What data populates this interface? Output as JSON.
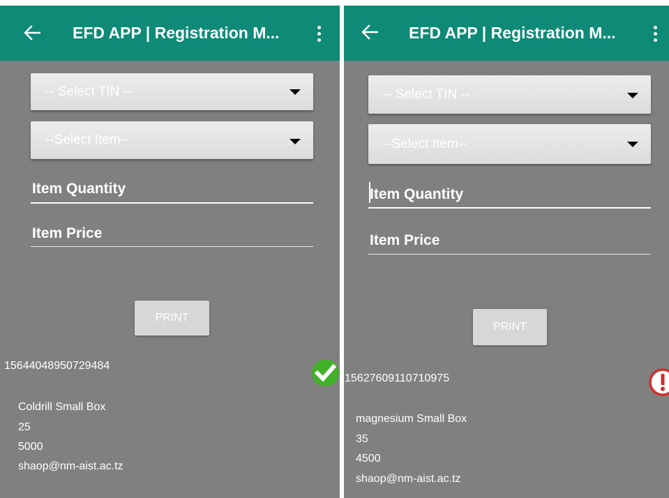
{
  "screens": [
    {
      "app_title": "EFD APP | Registration M...",
      "tin_select": {
        "selected": "-- Select TIN --"
      },
      "item_select": {
        "selected": "--Select Item--"
      },
      "quantity_field": {
        "placeholder": "Item Quantity"
      },
      "price_field": {
        "placeholder": "Item Price"
      },
      "print_label": "PRINT",
      "receipt": {
        "number": "15644048950729484",
        "item": "Coldrill Small Box",
        "quantity": "25",
        "price": "5000",
        "email": "shaop@nm-aist.ac.tz",
        "status_icon": "check-circle-icon",
        "status_color": "#43b02a"
      }
    },
    {
      "app_title": "EFD APP | Registration M...",
      "tin_select": {
        "selected": "-- Select TIN --"
      },
      "item_select": {
        "selected": "--Select Item--"
      },
      "quantity_field": {
        "placeholder": "Item Quantity"
      },
      "price_field": {
        "placeholder": "Item Price"
      },
      "print_label": "PRINT",
      "receipt": {
        "number": "15627609110710975",
        "item": "magnesium Small Box",
        "quantity": "35",
        "price": "4500",
        "email": "shaop@nm-aist.ac.tz",
        "status_icon": "error-exclamation-icon",
        "status_color": "#d42a2a"
      }
    }
  ],
  "colors": {
    "app_bar": "#0e8a76",
    "background": "#808080"
  }
}
